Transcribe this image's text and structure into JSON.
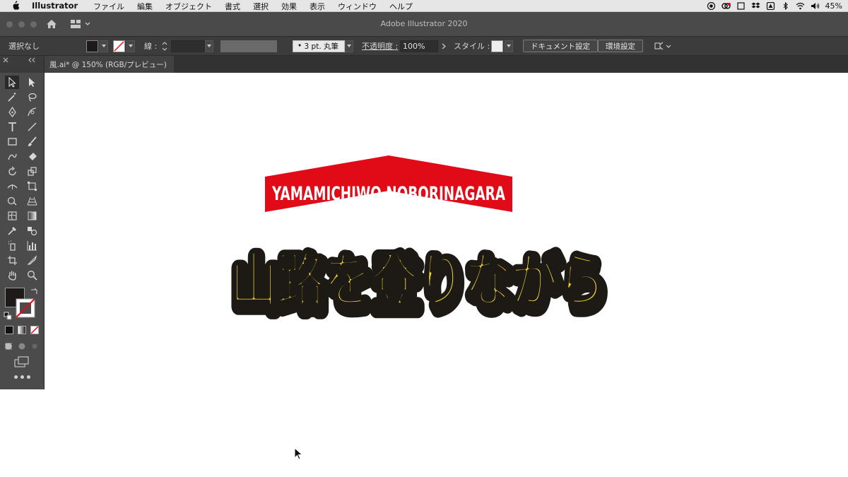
{
  "menubar": {
    "app_name": "Illustrator",
    "items": [
      "ファイル",
      "編集",
      "オブジェクト",
      "書式",
      "選択",
      "効果",
      "表示",
      "ウィンドウ",
      "ヘルプ"
    ],
    "battery_percent": "45%"
  },
  "window": {
    "title": "Adobe Illustrator 2020"
  },
  "controlbar": {
    "selection_label": "選択なし",
    "stroke_label": "線 :",
    "brush_label": "3 pt. 丸筆",
    "opacity_label": "不透明度 :",
    "opacity_value": "100%",
    "style_label": "スタイル :",
    "document_settings": "ドキュメント設定",
    "preferences": "環境設定"
  },
  "document": {
    "tab_label": "風.ai* @ 150% (RGB/プレビュー)"
  },
  "artwork": {
    "banner_text": "YAMAMICHIWO NOBORINAGARA",
    "main_text": "山路を登りながら",
    "banner_color": "#e10a17",
    "fill_color": "#f7d930",
    "outline_color": "#1d1a16"
  },
  "colors": {
    "fill_swatch": "#1f1a1a",
    "stroke_swatch": "#ffffff"
  }
}
